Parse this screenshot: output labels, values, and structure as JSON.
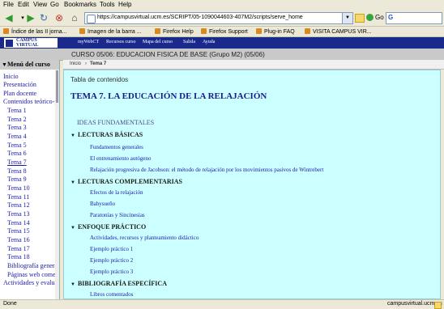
{
  "menu": [
    "File",
    "Edit",
    "View",
    "Go",
    "Bookmarks",
    "Tools",
    "Help"
  ],
  "toolbar": {
    "url": "https://campusvirtual.ucm.es/SCRIPT/05-1090044603-407M2/scripts/serve_home",
    "go_label": "Go",
    "search_placeholder": "G"
  },
  "bookmarks": [
    "Índice de las II jorna...",
    "Imagen de la barra ...",
    "Firefox Help",
    "Firefox Support",
    "Plug-in FAQ",
    "VISITA CAMPUS VIR..."
  ],
  "site": {
    "logo_line1": "CAMPUS",
    "logo_line2": "VIRTUAL",
    "nav": [
      "myWebCT",
      "Recursos curso",
      "Mapa del curso",
      "Salida",
      "Ayuda"
    ]
  },
  "course_title": "CURSO 05/06: EDUCACION FISICA DE BASE (Grupo M2) (05/06)",
  "sidebar": {
    "header": "Menú del curso",
    "items": [
      "Inicio",
      "Presentación",
      "Plan docente",
      "Contenidos teórico-p",
      "Tema 1",
      "Tema 2",
      "Tema 3",
      "Tema 4",
      "Tema 5",
      "Tema 6",
      "Tema 7",
      "Tema 8",
      "Tema 9",
      "Tema 10",
      "Tema 11",
      "Tema 12",
      "Tema 13",
      "Tema 14",
      "Tema 15",
      "Tema 16",
      "Tema 17",
      "Tema 18",
      "Bibliografía general",
      "Páginas web comer",
      "Actividades y evalua"
    ]
  },
  "breadcrumb": [
    "Inicio",
    "›",
    "Tema 7"
  ],
  "content": {
    "toc_label": "Tabla de contenidos",
    "title": "TEMA 7. LA EDUCACIÓN DE LA RELAJACIÓN",
    "ideas": "IDEAS FUNDAMENTALES",
    "sections": [
      {
        "title": "LECTURAS BÁSICAS",
        "links": [
          "Fundamentos generales",
          "El entrenamiento autógeno",
          "Relajación progresiva de Jacobson: el método de relajación por los movimientos pasivos de Wintrebert"
        ]
      },
      {
        "title": "LECTURAS COMPLEMENTARIAS",
        "links": [
          "Efectos de la relajación",
          "Babysueño",
          "Paratonías y Sincinesias"
        ]
      },
      {
        "title": "ENFOQUE PRÁCTICO",
        "links": [
          "Actividades, recursos y planteamiento didáctico",
          "Ejemplo práctico 1",
          "Ejemplo práctico 2",
          "Ejemplo práctico 3"
        ]
      },
      {
        "title": "BIBLIOGRAFÍA ESPECÍFICA",
        "links": [
          "Libros comentados"
        ]
      }
    ]
  },
  "status": {
    "left": "Done",
    "right": "campusvirtual.ucm.es"
  }
}
